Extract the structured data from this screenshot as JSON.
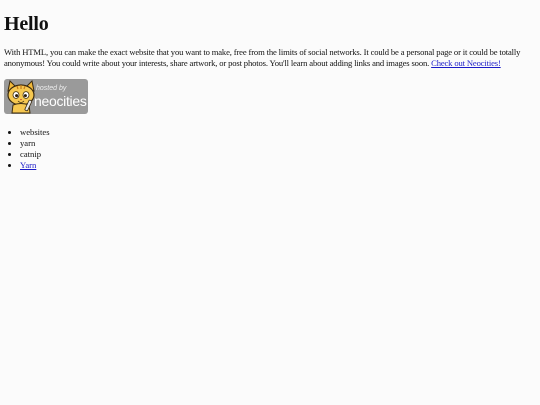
{
  "page": {
    "title": "Hello",
    "intro_text": "With HTML, you can make the exact website that you want to make, free from the limits of social networks. It could be a personal page or it could be totally anonymous! You could write about your interests, share artwork, or post photos. You'll learn about adding links and images soon.",
    "intro_link": "Check out Neocities!",
    "badge": {
      "hosted_label": "hosted by",
      "brand_label": "neocities"
    },
    "list": [
      {
        "label": "websites"
      },
      {
        "label": "yarn"
      },
      {
        "label": "catnip"
      },
      {
        "label": "Yarn",
        "is_link": true
      }
    ]
  },
  "colors": {
    "background": "#fbfbfb",
    "link": "#1a1ac8",
    "badge_background": "#9a9a9a"
  }
}
